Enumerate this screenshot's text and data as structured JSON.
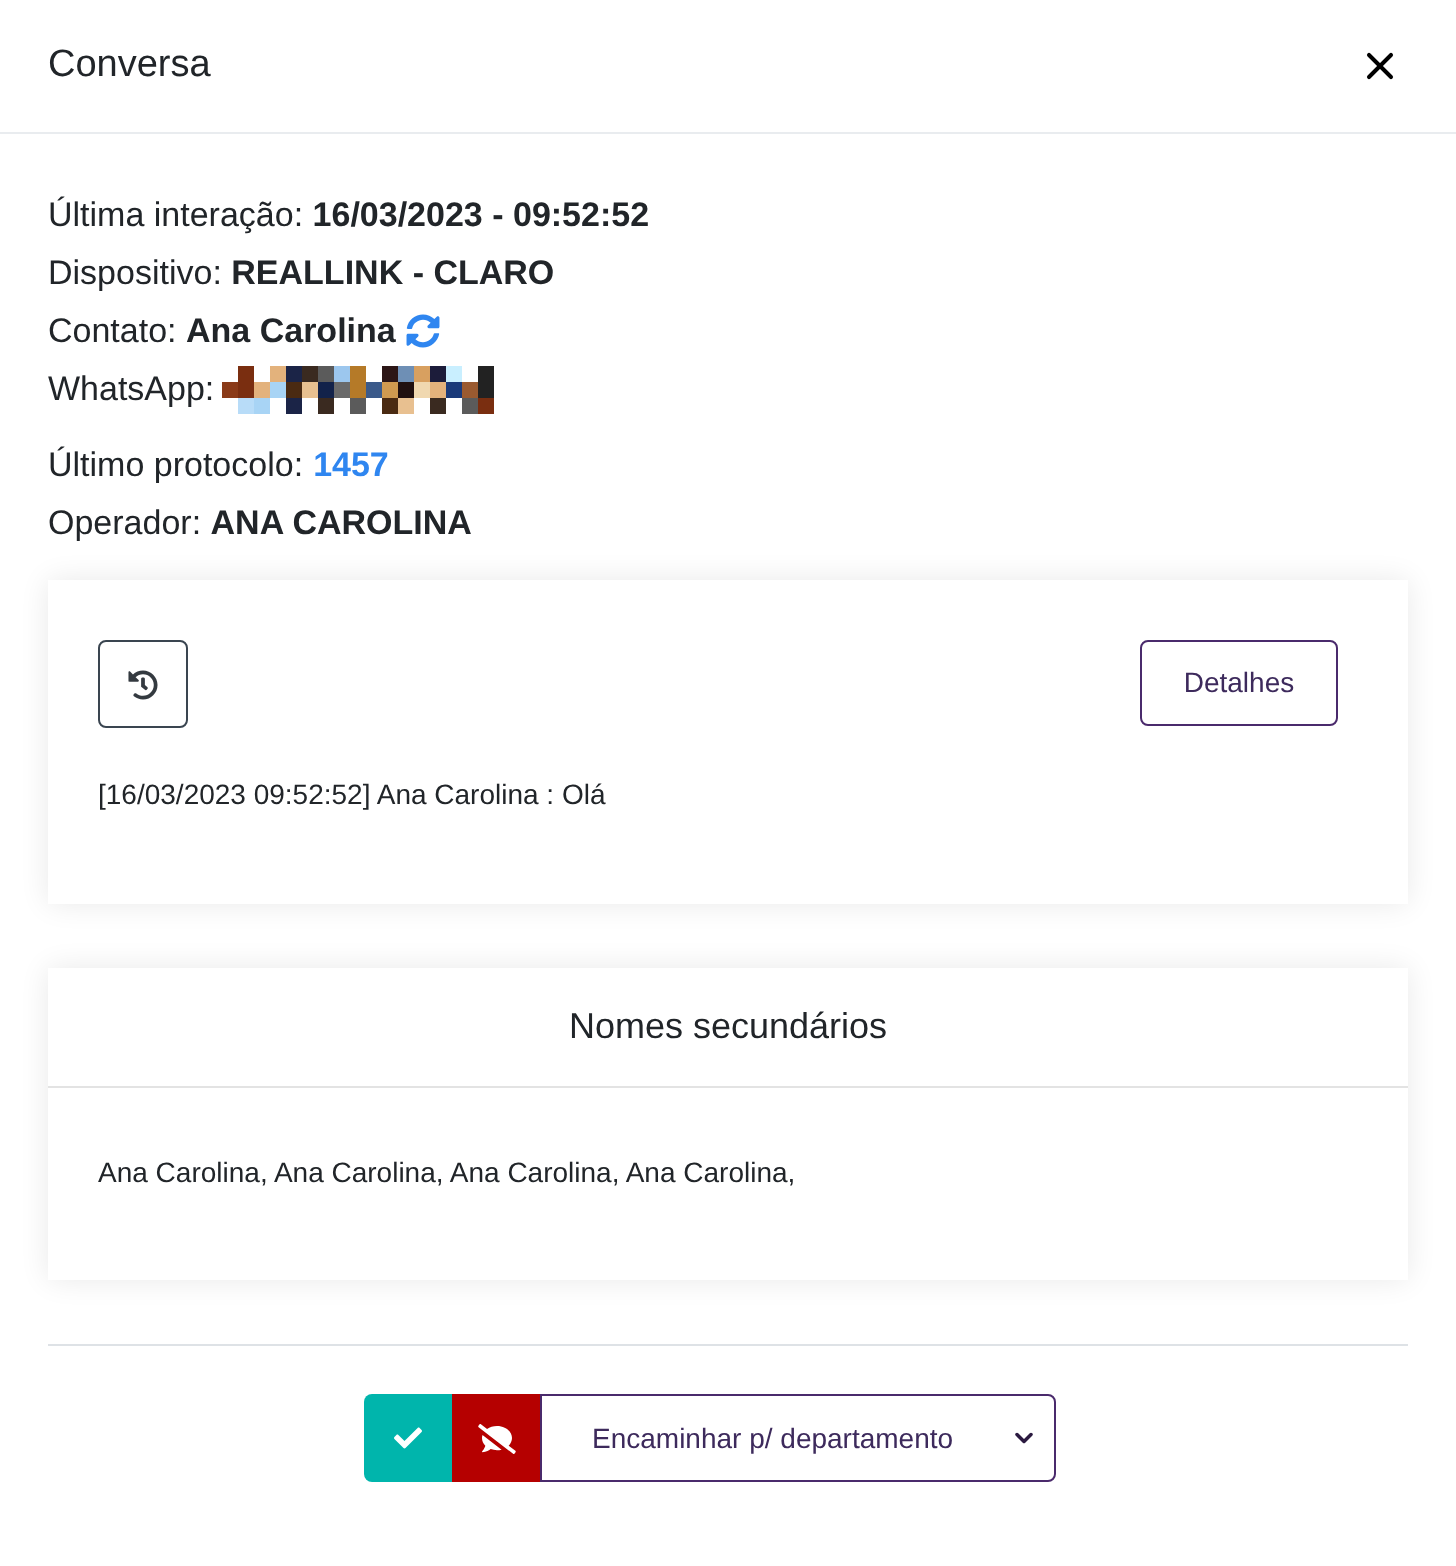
{
  "dialog": {
    "title": "Conversa"
  },
  "info": [
    {
      "kind": "bold",
      "label": "Última interação:",
      "value": "16/03/2023 - 09:52:52"
    },
    {
      "kind": "bold",
      "label": "Dispositivo:",
      "value": "REALLINK - CLARO"
    },
    {
      "kind": "refresh",
      "label": "Contato:",
      "value": "Ana Carolina"
    },
    {
      "kind": "redacted",
      "label": "WhatsApp:"
    },
    {
      "kind": "link",
      "label": "Último protocolo:",
      "value": "1457"
    },
    {
      "kind": "bold",
      "label": "Operador:",
      "value": "ANA CAROLINA"
    }
  ],
  "messages_card": {
    "details_button": "Detalhes",
    "messages": [
      "[16/03/2023 09:52:52] Ana Carolina : Olá"
    ]
  },
  "secondary_names": {
    "title": "Nomes secundários",
    "text": "Ana Carolina, Ana Carolina, Ana Carolina, Ana Carolina,"
  },
  "footer": {
    "forward_select": {
      "value": "Encaminhar p/ departamento"
    }
  }
}
